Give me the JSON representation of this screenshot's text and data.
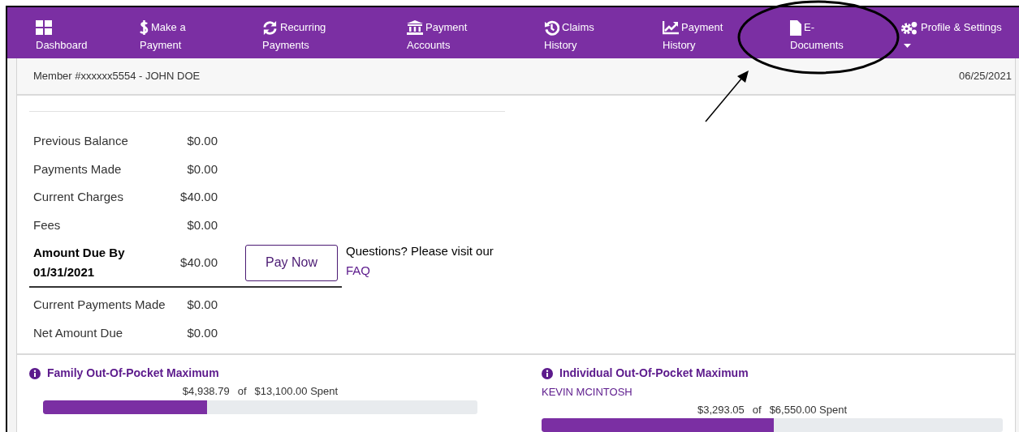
{
  "nav_items": [
    {
      "line2": "Dashboard",
      "dropdown": false
    },
    {
      "line1": "Make a",
      "line2": "Payment",
      "dropdown": false
    },
    {
      "line1": "Recurring",
      "line2": "Payments",
      "dropdown": false
    },
    {
      "line1": "Payment",
      "line2": "Accounts",
      "dropdown": false
    },
    {
      "line1": "Claims",
      "line2": "History",
      "dropdown": false
    },
    {
      "line1": "Payment",
      "line2": "History",
      "dropdown": false
    },
    {
      "line1": "E-",
      "line2": "Documents",
      "dropdown": false
    },
    {
      "line1": "Profile & Settings",
      "dropdown": true
    }
  ],
  "member_bar": {
    "member": "Member #xxxxxx5554 - JOHN DOE",
    "date": "06/25/2021"
  },
  "balance_rows": [
    {
      "label": "Previous Balance",
      "value": "$0.00",
      "kind": "normal"
    },
    {
      "label": "Payments Made",
      "value": "$0.00",
      "kind": "normal"
    },
    {
      "label": "Current Charges",
      "value": "$40.00",
      "kind": "normal"
    },
    {
      "label": "Fees",
      "value": "$0.00",
      "kind": "normal"
    },
    {
      "label": "Amount Due By 01/31/2021",
      "value": "$40.00",
      "kind": "due"
    },
    {
      "label": "Current Payments Made",
      "value": "$0.00",
      "kind": "normal"
    },
    {
      "label": "Net Amount Due",
      "value": "$0.00",
      "kind": "normal"
    }
  ],
  "pay_button": "Pay Now",
  "questions": {
    "text": "Questions? Please visit our",
    "link": "FAQ"
  },
  "maximums": [
    {
      "title": "Family Out-Of-Pocket Maximum",
      "spent": "$4,938.79",
      "of": "of",
      "total": "$13,100.00 Spent",
      "level": 0.377
    },
    {
      "title": "Individual Out-Of-Pocket Maximum",
      "person": "KEVIN MCINTOSH",
      "spent": "$3,293.05",
      "of": "of",
      "total": "$6,550.00 Spent",
      "level": 0.503
    }
  ]
}
